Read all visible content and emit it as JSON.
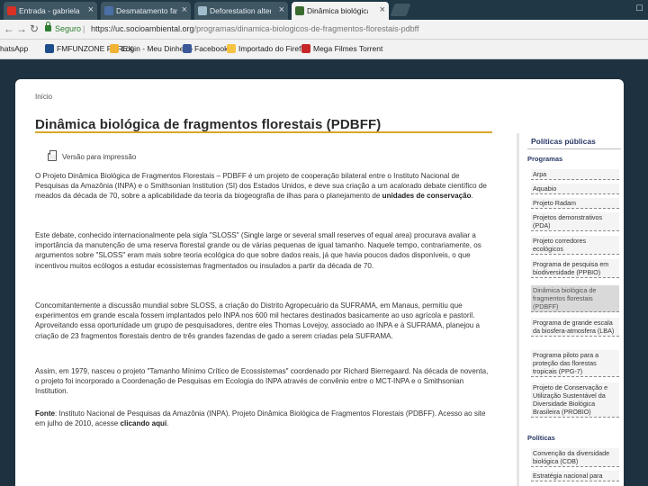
{
  "browser": {
    "tabs": [
      {
        "title": "Entrada - gabriela.isel",
        "favicon_color": "#d93025",
        "active": false
      },
      {
        "title": "Desmatamento favorece",
        "favicon_color": "#4a6fa5",
        "active": false
      },
      {
        "title": "Deforestation alters the",
        "favicon_color": "#9fbbcc",
        "active": false
      },
      {
        "title": "Dinâmica biológica de",
        "favicon_color": "#3a6b2e",
        "active": true
      }
    ],
    "tab_close": "×",
    "secure_label": "Seguro",
    "url_host": "https://uc.socioambiental.org",
    "url_path": "/programas/dinamica-biologicos-de-fragmentos-florestais-pdbff",
    "bookmarks": [
      {
        "label": "WhatsApp",
        "icon_color": "#25d366"
      },
      {
        "label": "FMFUNZONE FOREX",
        "icon_color": "#1e4d8c"
      },
      {
        "label": "Login - Meu Dinheiro",
        "icon_color": "#f2b233"
      },
      {
        "label": "Facebook",
        "icon_color": "#3b5998"
      },
      {
        "label": "Importado do Firefox",
        "icon_color": "#f5c242"
      },
      {
        "label": "Mega Filmes Torrent",
        "icon_color": "#c62828"
      }
    ]
  },
  "page": {
    "breadcrumb": "Início",
    "title": "Dinâmica biológica de fragmentos florestais (PDBFF)",
    "print_label": "Versão para impressão",
    "paragraphs": [
      {
        "text": "O Projeto Dinâmica Biológica de Fragmentos Florestais – PDBFF é um projeto de cooperação bilateral entre o Instituto Nacional de Pesquisas da Amazônia (INPA) e o Smithsonian Institution (SI) dos Estados Unidos, e deve sua criação a um acalorado debate científico de meados da década de 70, sobre a aplicabilidade da teoria da biogeografia de ilhas para o planejamento de ",
        "bold": "unidades de conservação",
        "after": "."
      },
      {
        "text": "Este debate, conhecido internacionalmente pela sigla \"SLOSS\" (Single large or several small reserves of equal area) procurava avaliar a importância da manutenção de uma reserva florestal grande ou de várias pequenas de igual tamanho. Naquele tempo, contrariamente, os argumentos sobre \"SLOSS\" eram mais sobre teoria ecológica do que sobre dados reais, já que havia poucos dados disponíveis, o que incentivou muitos ecólogos a estudar ecossistemas fragmentados ou insulados a partir da década de 70.",
        "bold": "",
        "after": ""
      },
      {
        "text": "Concomitantemente a discussão mundial sobre SLOSS, a criação do Distrito Agropecuário da SUFRAMA, em Manaus, permitiu que experimentos em grande escala fossem implantados pelo INPA nos 600 mil hectares destinados basicamente ao uso agrícola e pastoril. Aproveitando essa oportunidade um grupo de pesquisadores, dentre eles Thomas Lovejoy, associado ao INPA e à SUFRAMA, planejou a criação de 23 fragmentos florestais dentro de três grandes fazendas de gado a serem criadas pela SUFRAMA.",
        "bold": "",
        "after": ""
      },
      {
        "text": "Assim, em 1979, nasceu o projeto \"Tamanho Mínimo Crítico de Ecossistemas\" coordenado por Richard Bierregaard. Na década de noventa, o projeto foi incorporado a Coordenação de Pesquisas em Ecologia do INPA através de convênio entre o MCT-INPA e o Smithsonian Institution.",
        "bold": "",
        "after": ""
      },
      {
        "text": "",
        "lead": "Fonte",
        "body": ": Instituto Nacional de Pesquisas da Amazônia (INPA). Projeto Dinâmica Biológica de Fragmentos Florestais (PDBFF). Acesso ao site em julho de 2010, acesse ",
        "bold": "clicando aqui",
        "after": "."
      }
    ]
  },
  "sidebar": {
    "heading": "Políticas públicas",
    "sub_programs": "Programas",
    "programs": [
      "Arpa",
      "Aquabio",
      "Projeto Radam",
      "Projetos demonstrativos (PDA)",
      "Projeto corredores ecológicos",
      "Programa de pesquisa em biodiversidade (PPBIO)",
      "Dinâmica biológica de fragmentos florestais (PDBFF)",
      "Programa de grande escala da biosfera-atmosfera (LBA)",
      "Programa piloto para a proteção das florestas tropicais (PPG-7)",
      "Projeto de Conservação e Utilização Sustentável da Diversidade Biológica Brasileira (PROBIO)"
    ],
    "sub_policies": "Políticas",
    "policies": [
      "Convenção da diversidade biológica (CDB)",
      "Estratégia nacional para"
    ]
  }
}
